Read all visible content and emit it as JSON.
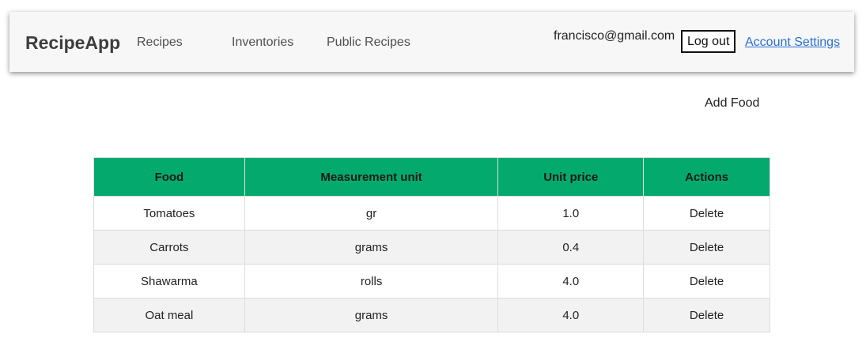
{
  "navbar": {
    "brand": "RecipeApp",
    "links": {
      "recipes": "Recipes",
      "inventories": "Inventories",
      "public_recipes": "Public Recipes"
    },
    "user_email": "francisco@gmail.com",
    "logout_label": "Log out",
    "account_settings_label": "Account Settings"
  },
  "add_food_label": "Add Food",
  "table": {
    "headers": {
      "food": "Food",
      "unit": "Measurement unit",
      "price": "Unit price",
      "actions": "Actions"
    },
    "rows": [
      {
        "food": "Tomatoes",
        "unit": "gr",
        "price": "1.0",
        "action": "Delete"
      },
      {
        "food": "Carrots",
        "unit": "grams",
        "price": "0.4",
        "action": "Delete"
      },
      {
        "food": "Shawarma",
        "unit": "rolls",
        "price": "4.0",
        "action": "Delete"
      },
      {
        "food": "Oat meal",
        "unit": "grams",
        "price": "4.0",
        "action": "Delete"
      }
    ]
  },
  "colors": {
    "table_header": "#04aa6d",
    "link": "#2a6fd6",
    "navbar_bg": "#f7f7f7"
  }
}
